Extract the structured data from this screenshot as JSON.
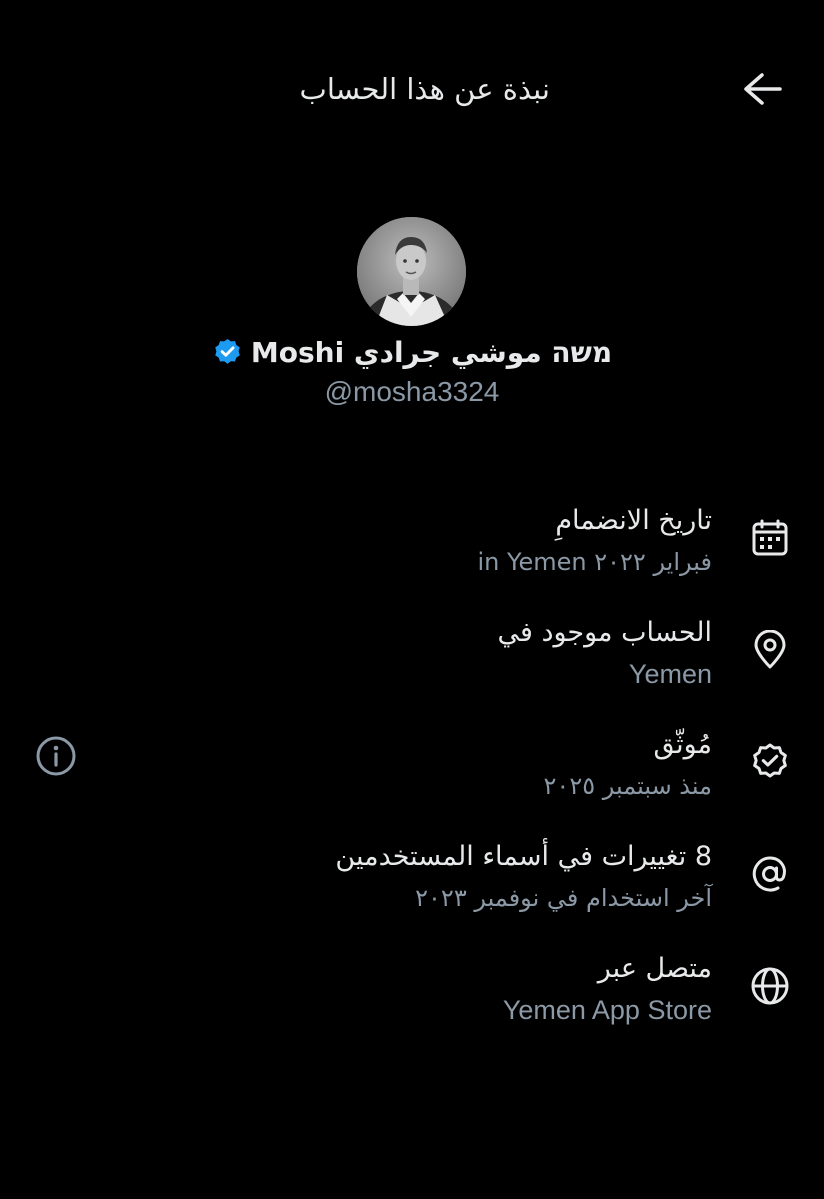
{
  "header": {
    "title": "نبذة عن هذا الحساب",
    "back_icon": "arrow-right-icon"
  },
  "profile": {
    "display_name": "משה موشي جرادي Moshi",
    "handle": "@mosha3324",
    "verified_icon": "verified-badge-icon",
    "verified_color": "#1d9bf0"
  },
  "rows": [
    {
      "icon": "calendar-icon",
      "title": "تاريخ الانضمامِ",
      "subtitle": "فبراير ٢٠٢٢ in Yemen"
    },
    {
      "icon": "location-pin-icon",
      "title": "الحساب موجود في",
      "subtitle": "Yemen"
    },
    {
      "icon": "verified-outline-icon",
      "title": "مُوثّق",
      "subtitle": "منذ سبتمبر ٢٠٢٥"
    },
    {
      "icon": "at-sign-icon",
      "title": "8 تغييرات في أسماء المستخدمين",
      "subtitle": "آخر استخدام في نوفمبر ٢٠٢٣"
    },
    {
      "icon": "globe-icon",
      "title": "متصل عبر",
      "subtitle": "Yemen App Store"
    }
  ],
  "info_icon": "info-icon",
  "colors": {
    "background": "#000000",
    "primary_text": "#e7e9ea",
    "secondary_text": "#8b98a5",
    "accent": "#1d9bf0"
  }
}
